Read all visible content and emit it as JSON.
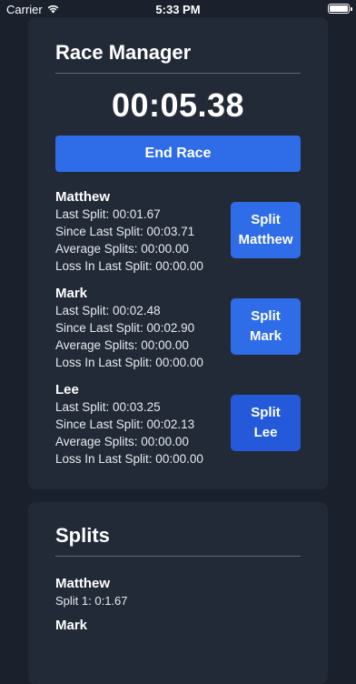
{
  "status_bar": {
    "carrier": "Carrier",
    "time": "5:33 PM",
    "battery_level": 1.0
  },
  "race_manager": {
    "title": "Race Manager",
    "timer": "00:05.38",
    "end_race_label": "End Race",
    "racers": [
      {
        "name": "Matthew",
        "last_split": "Last Split: 00:01.67",
        "since_last_split": "Since Last Split: 00:03.71",
        "average_splits": "Average Splits: 00:00.00",
        "loss_in_last_split": "Loss In Last Split: 00:00.00",
        "button_line1": "Split",
        "button_line2": "Matthew"
      },
      {
        "name": "Mark",
        "last_split": "Last Split: 00:02.48",
        "since_last_split": "Since Last Split: 00:02.90",
        "average_splits": "Average Splits: 00:00.00",
        "loss_in_last_split": "Loss In Last Split: 00:00.00",
        "button_line1": "Split",
        "button_line2": "Mark"
      },
      {
        "name": "Lee",
        "last_split": "Last Split: 00:03.25",
        "since_last_split": "Since Last Split: 00:02.13",
        "average_splits": "Average Splits: 00:00.00",
        "loss_in_last_split": "Loss In Last Split: 00:00.00",
        "button_line1": "Split",
        "button_line2": "Lee"
      }
    ]
  },
  "splits": {
    "title": "Splits",
    "racers": [
      {
        "name": "Matthew",
        "splits": [
          "Split 1: 0:1.67"
        ]
      },
      {
        "name": "Mark",
        "splits": []
      }
    ]
  },
  "colors": {
    "background": "#1a202c",
    "card": "#222a38",
    "accent": "#2e6ce8"
  }
}
